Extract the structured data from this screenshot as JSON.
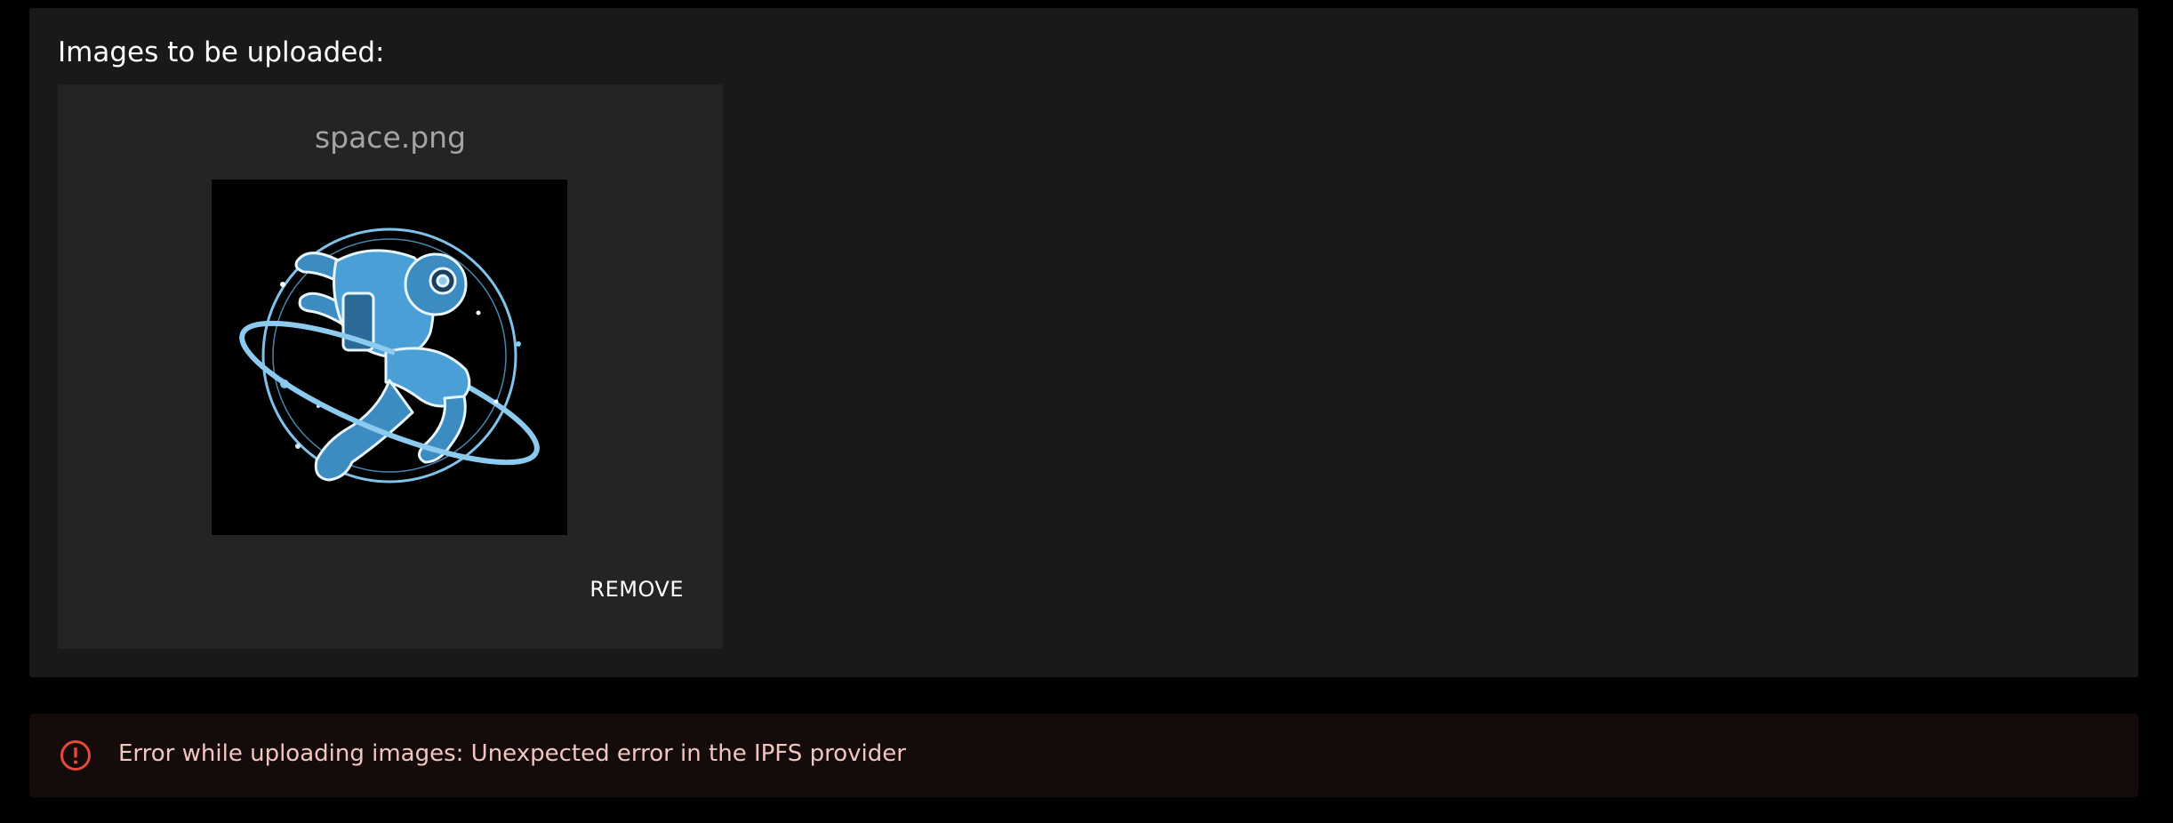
{
  "upload_panel": {
    "heading": "Images to be uploaded:",
    "images": [
      {
        "file_name": "space.png",
        "preview_icon": "astronaut-image",
        "remove_label": "REMOVE"
      }
    ]
  },
  "error_banner": {
    "icon": "error-circle-icon",
    "message": "Error while uploading images: Unexpected error in the IPFS provider"
  },
  "colors": {
    "background": "#000000",
    "panel": "#181a19",
    "card": "#232524",
    "error_background": "#160b0b",
    "error_icon": "#e5483c",
    "error_text": "#f1c6c1",
    "astronaut_blue": "#5aa9dc"
  }
}
